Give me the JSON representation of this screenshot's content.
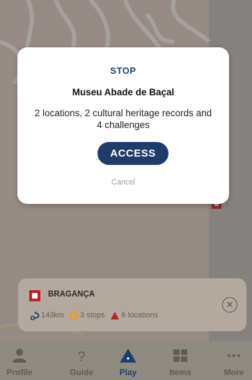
{
  "modal": {
    "kicker": "STOP",
    "title": "Museu Abade de Baçal",
    "description": "2 locations, 2 cultural heritage records and 4 challenges",
    "access_label": "ACCESS",
    "cancel_label": "Cancel"
  },
  "route_card": {
    "title": "BRAGANÇA",
    "distance": "143km",
    "stops": "3 stops",
    "locations": "6 locations",
    "close_icon": "close-circle-icon"
  },
  "bottom_nav": {
    "items": [
      {
        "label": "Profile",
        "icon": "person-icon"
      },
      {
        "label": "Guide",
        "icon": "question-icon"
      },
      {
        "label": "Play",
        "icon": "play-triangle-icon",
        "active": true
      },
      {
        "label": "Items",
        "icon": "grid-icon"
      },
      {
        "label": "More",
        "icon": "more-dots-icon"
      }
    ]
  },
  "colors": {
    "accent": "#1f3d6b",
    "marker_red": "#c22020",
    "stop_orange": "#e8a020"
  }
}
